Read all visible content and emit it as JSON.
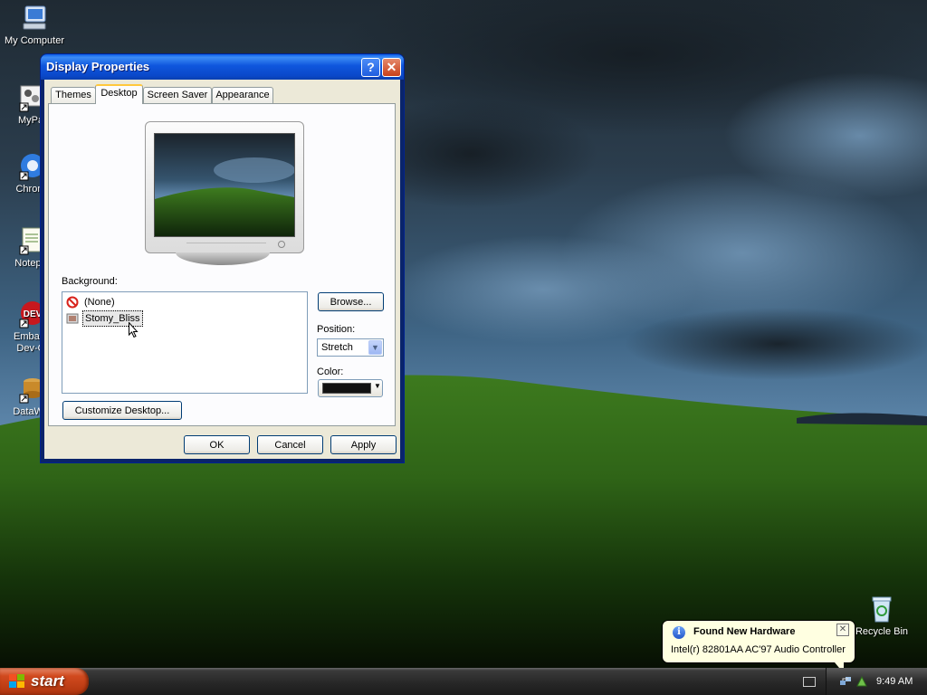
{
  "desktop": {
    "icons": [
      {
        "label": "My Computer"
      },
      {
        "label": "MyPa"
      },
      {
        "label": "Chrom"
      },
      {
        "label": "Notepa"
      },
      {
        "label": "Embarc",
        "label2": "Dev-C"
      },
      {
        "label": "DataWa"
      },
      {
        "label": "Recycle Bin"
      }
    ]
  },
  "window": {
    "title": "Display Properties",
    "help_glyph": "?",
    "close_glyph": "✕",
    "tabs": [
      "Themes",
      "Desktop",
      "Screen Saver",
      "Appearance"
    ],
    "active_tab": "Desktop",
    "background_label": "Background:",
    "background_items": [
      "(None)",
      "Stomy_Bliss"
    ],
    "selected_background": "Stomy_Bliss",
    "browse_label": "Browse...",
    "position_label": "Position:",
    "position_value": "Stretch",
    "color_label": "Color:",
    "color_value": "#111111",
    "customize_label": "Customize Desktop...",
    "ok_label": "OK",
    "cancel_label": "Cancel",
    "apply_label": "Apply"
  },
  "taskbar": {
    "start_label": "start",
    "clock": "9:49 AM"
  },
  "balloon": {
    "title": "Found New Hardware",
    "text": "Intel(r) 82801AA AC'97 Audio Controller",
    "info_glyph": "i",
    "close_glyph": "✕"
  },
  "colors": {
    "title_bar": "#0a48c9",
    "dialog_bg": "#ece9d8",
    "start_button": "#c9401a",
    "balloon_bg": "#ffffe1"
  }
}
